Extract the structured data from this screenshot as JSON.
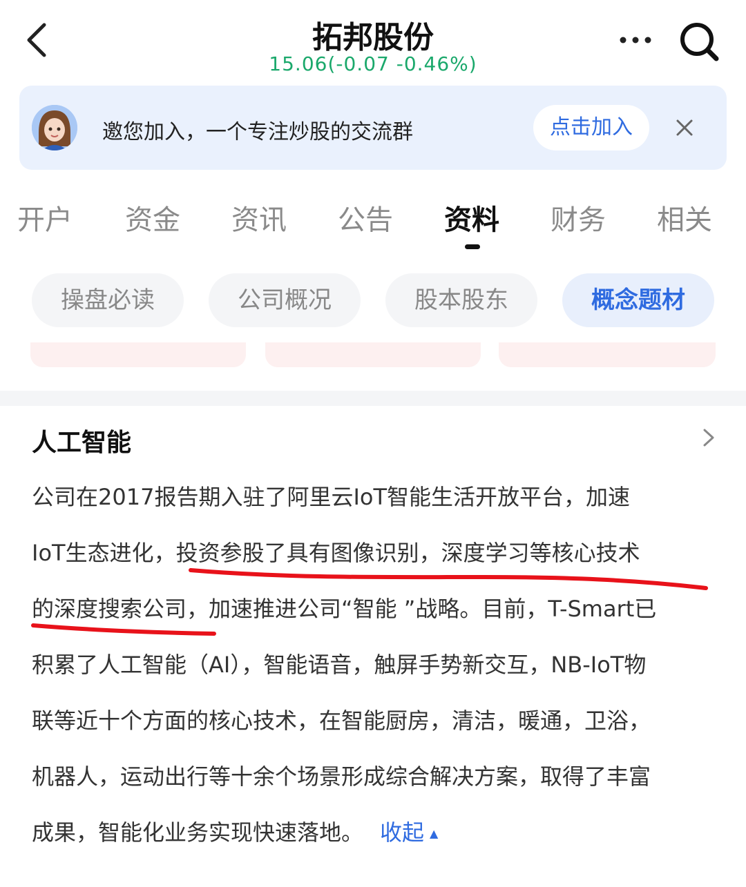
{
  "header": {
    "title": "拓邦股份",
    "quote": "15.06(-0.07 -0.46%)"
  },
  "banner": {
    "text": "邀您加入，一个专注炒股的交流群",
    "join_label": "点击加入"
  },
  "tabs": [
    {
      "label": "开户"
    },
    {
      "label": "资金"
    },
    {
      "label": "资讯"
    },
    {
      "label": "公告"
    },
    {
      "label": "资料"
    },
    {
      "label": "财务"
    },
    {
      "label": "相关"
    }
  ],
  "sub_tabs": [
    {
      "label": "操盘必读"
    },
    {
      "label": "公司概况"
    },
    {
      "label": "股本股东"
    },
    {
      "label": "概念题材"
    }
  ],
  "section": {
    "title": "人工智能",
    "lines": [
      "公司在2017报告期入驻了阿里云IoT智能生活开放平台，加速",
      "IoT生态进化，投资参股了具有图像识别，深度学习等核心技术",
      "的深度搜索公司，加速推进公司“智能 ”战略。目前，T-Smart已",
      "积累了人工智能（AI），智能语音，触屏手势新交互，NB-IoT物",
      "联等近十个方面的核心技术，在智能厨房，清洁，暖通，卫浴，",
      "机器人，运动出行等十余个场景形成综合解决方案，取得了丰富",
      "成果，智能化业务实现快速落地。"
    ],
    "collapse_label": "收起"
  },
  "colors": {
    "accent": "#2f6be0",
    "up_down_green": "#1aa86b",
    "annotation_red": "#e8121a"
  }
}
